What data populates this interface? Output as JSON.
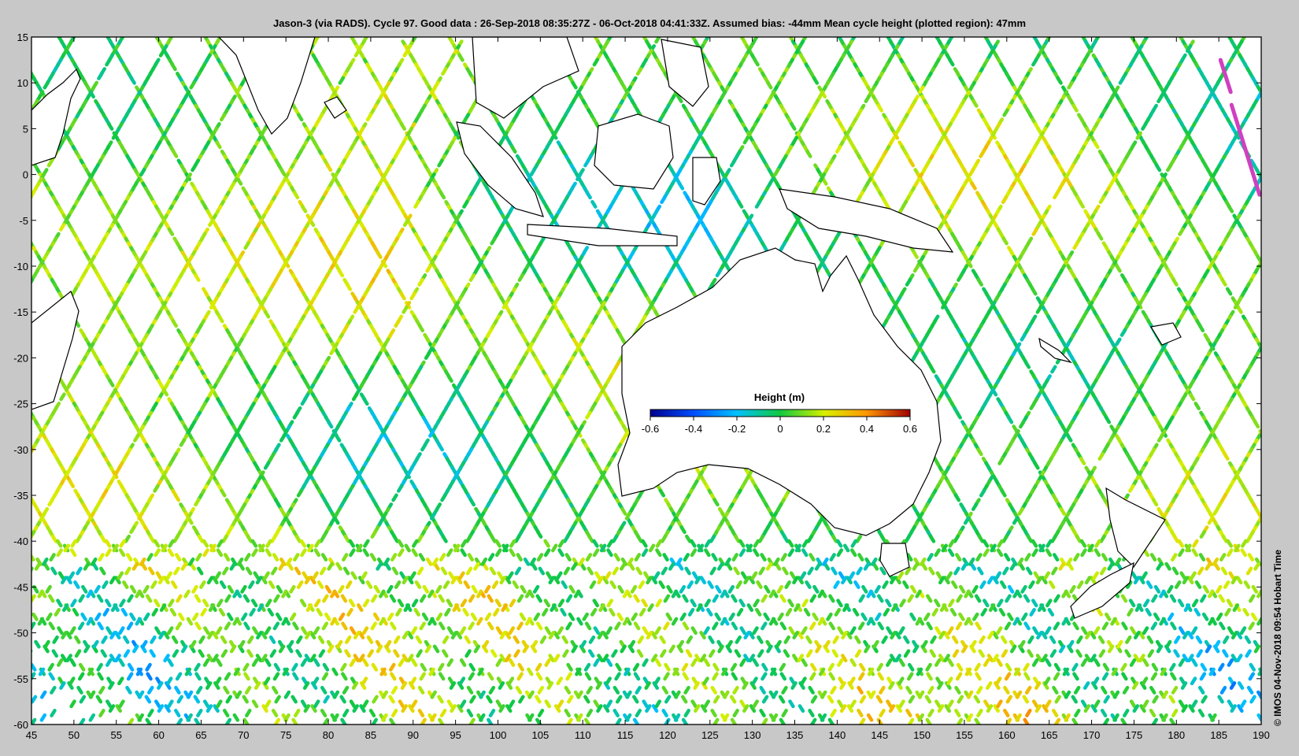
{
  "title": "Jason-3 (via RADS). Cycle 97. Good data : 26-Sep-2018 08:35:27Z - 06-Oct-2018 04:41:33Z. Assumed bias: -44mm  Mean cycle height (plotted region): 47mm",
  "credit": "© IMOS 04-Nov-2018 09:54 Hobart Time",
  "axes": {
    "x_ticks": [
      "45",
      "50",
      "55",
      "60",
      "65",
      "70",
      "75",
      "80",
      "85",
      "90",
      "95",
      "100",
      "105",
      "110",
      "115",
      "120",
      "125",
      "130",
      "135",
      "140",
      "145",
      "150",
      "155",
      "160",
      "165",
      "170",
      "175",
      "180",
      "185",
      "190"
    ],
    "y_ticks": [
      "15",
      "10",
      "5",
      "0",
      "-5",
      "-10",
      "-15",
      "-20",
      "-25",
      "-30",
      "-35",
      "-40",
      "-45",
      "-50",
      "-55",
      "-60"
    ],
    "lon_range": [
      45,
      190
    ],
    "lat_range": [
      -60,
      15
    ]
  },
  "colorbar": {
    "title": "Height (m)",
    "tick_labels": [
      "-0.6",
      "-0.4",
      "-0.2",
      "0",
      "0.2",
      "0.4",
      "0.6"
    ],
    "range": [
      -0.6,
      0.6
    ],
    "colors": [
      "#00008f",
      "#0050ff",
      "#00c0ff",
      "#10c840",
      "#d8f000",
      "#ff9800",
      "#a00000"
    ]
  },
  "colors": {
    "background": "#c8c8c8",
    "plot_bg": "#ffffff",
    "anomaly_track": "#d040c0"
  }
}
